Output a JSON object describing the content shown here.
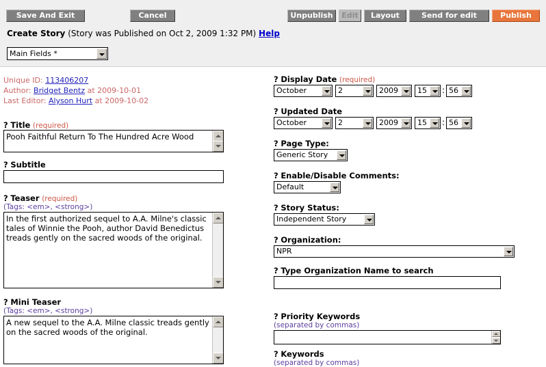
{
  "toolbar": {
    "save_and_exit": "Save And Exit",
    "cancel": "Cancel",
    "unpublish": "Unpublish",
    "edit": "Edit",
    "layout": "Layout",
    "send_for_edit": "Send for edit",
    "publish": "Publish",
    "publish_color": "#e8763c",
    "button_color": "#808080",
    "disabled_color": "#b9b9b9"
  },
  "header": {
    "page_title": "Create Story",
    "publish_note": "(Story was Published on Oct 2, 2009 1:32 PM)",
    "help_label": "Help",
    "view_select": "Main Fields *"
  },
  "meta": {
    "unique_id_label": "Unique ID:",
    "unique_id_value": "113406207",
    "author_label": "Author:",
    "author_name": "Bridget Bentz",
    "author_at": "at 2009-10-01",
    "editor_label": "Last Editor:",
    "editor_name": "Alyson Hurt",
    "editor_at": "at 2009-10-02"
  },
  "left": {
    "title": {
      "label": "Title",
      "required": "(required)",
      "value": "Pooh Faithful Return To The Hundred Acre Wood"
    },
    "subtitle": {
      "label": "Subtitle",
      "value": ""
    },
    "teaser": {
      "label": "Teaser",
      "required": "(required)",
      "tags": "(Tags: <em>, <strong>)",
      "value": "In the first authorized sequel to A.A. Milne's classic tales of Winnie the Pooh, author David Benedictus treads gently on the sacred woods of the original."
    },
    "mini_teaser": {
      "label": "Mini Teaser",
      "tags": "(Tags: <em>, <strong>)",
      "value": "A new sequel to the A.A. Milne classic treads gently on the sacred woods of the original."
    }
  },
  "right": {
    "display_date": {
      "label": "Display Date",
      "required": "(required)",
      "month": "October",
      "day": "2",
      "year": "2009",
      "hour": "15",
      "minute": "56",
      "separator": ":"
    },
    "updated_date": {
      "label": "Updated Date",
      "month": "October",
      "day": "2",
      "year": "2009",
      "hour": "15",
      "minute": "56",
      "separator": ":"
    },
    "page_type": {
      "label": "Page Type:",
      "value": "Generic Story"
    },
    "comments": {
      "label": "Enable/Disable Comments:",
      "value": "Default"
    },
    "story_status": {
      "label": "Story Status:",
      "value": "Independent Story"
    },
    "organization": {
      "label": "Organization:",
      "value": "NPR"
    },
    "org_search": {
      "label": "Type Organization Name to search",
      "value": ""
    },
    "priority_keywords": {
      "label": "Priority Keywords",
      "hint": "(separated by commas)",
      "value": ""
    },
    "keywords": {
      "label": "Keywords",
      "hint": "(separated by commas)",
      "value": ""
    }
  }
}
